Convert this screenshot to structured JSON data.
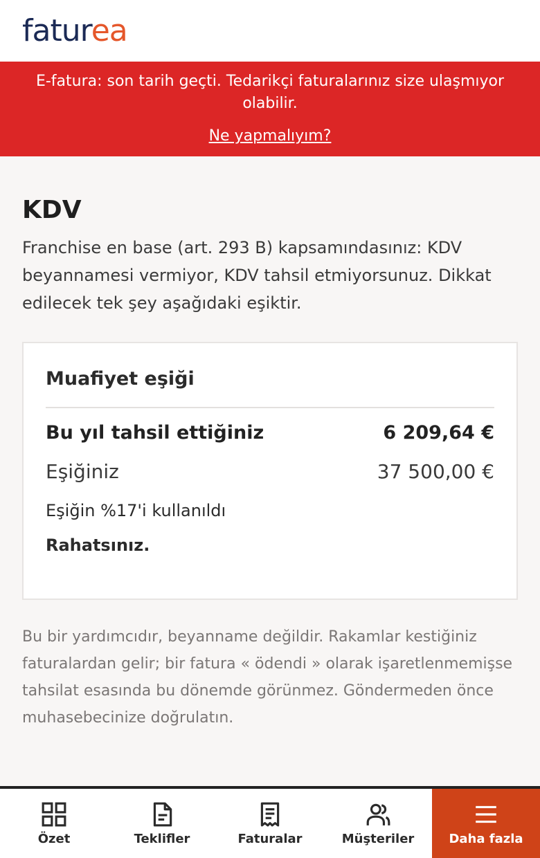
{
  "header": {
    "logo_dark": "fatur",
    "logo_accent": "ea"
  },
  "banner": {
    "text": "E-fatura: son tarih geçti. Tedarikçi faturalarınız size ulaşmıyor olabilir.",
    "link": "Ne yapmalıyım?"
  },
  "page": {
    "title": "KDV",
    "intro": "Franchise en base (art. 293 B) kapsamındasınız: KDV beyannamesi vermiyor, KDV tahsil etmiyorsunuz. Dikkat edilecek tek şey aşağıdaki eşiktir."
  },
  "card": {
    "title": "Muafiyet eşiği",
    "collected_label": "Bu yıl tahsil ettiğiniz",
    "collected_value": "6 209,64 €",
    "threshold_label": "Eşiğiniz",
    "threshold_value": "37 500,00 €",
    "usage_text": "Eşiğin %17'i kullanıldı",
    "usage_percent": 17,
    "status_text": "Rahatsınız."
  },
  "disclaimer": "Bu bir yardımcıdır, beyanname değildir. Rakamlar kestiğiniz faturalardan gelir; bir fatura « ödendi » olarak işaretlenmemişse tahsilat esasında bu dönemde görünmez. Göndermeden önce muhasebecinize doğrulatın.",
  "nav": {
    "items": [
      {
        "label": "Özet",
        "icon": "grid-icon"
      },
      {
        "label": "Teklifler",
        "icon": "document-icon"
      },
      {
        "label": "Faturalar",
        "icon": "receipt-icon"
      },
      {
        "label": "Müşteriler",
        "icon": "users-icon"
      },
      {
        "label": "Daha fazla",
        "icon": "menu-icon"
      }
    ],
    "active_color": "#cf4318"
  },
  "colors": {
    "brand_dark": "#1b2a55",
    "brand_accent": "#e5572b",
    "banner_red": "#dc2626"
  }
}
